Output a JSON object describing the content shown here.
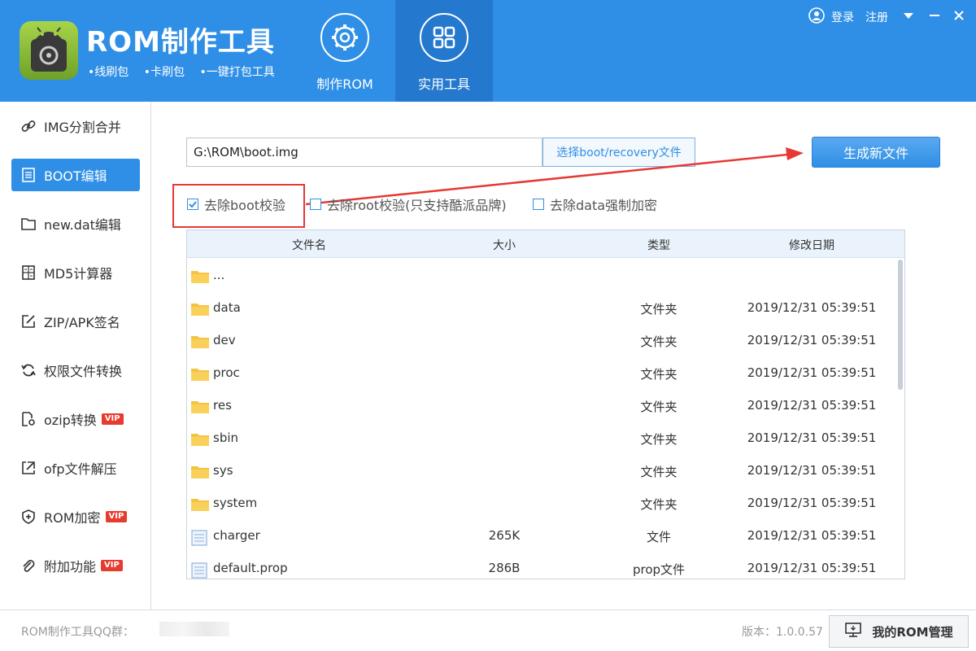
{
  "app": {
    "title": "ROM制作工具",
    "tags": [
      "•线刷包",
      "•卡刷包",
      "•一键打包工具"
    ]
  },
  "nav_tabs": [
    {
      "label": "制作ROM",
      "icon": "gear-icon"
    },
    {
      "label": "实用工具",
      "icon": "grid-icon",
      "active": true
    }
  ],
  "topbar": {
    "login": "登录",
    "register": "注册"
  },
  "sidebar": {
    "items": [
      {
        "label": "IMG分割合并",
        "icon": "link-icon"
      },
      {
        "label": "BOOT编辑",
        "icon": "document-icon",
        "active": true
      },
      {
        "label": "new.dat编辑",
        "icon": "folder-icon"
      },
      {
        "label": "MD5计算器",
        "icon": "calculator-icon"
      },
      {
        "label": "ZIP/APK签名",
        "icon": "edit-icon"
      },
      {
        "label": "权限文件转换",
        "icon": "refresh-icon"
      },
      {
        "label": "ozip转换",
        "icon": "file-gear-icon",
        "vip": "VIP"
      },
      {
        "label": "ofp文件解压",
        "icon": "extract-icon"
      },
      {
        "label": "ROM加密",
        "icon": "shield-icon",
        "vip": "VIP"
      },
      {
        "label": "附加功能",
        "icon": "paperclip-icon",
        "vip": "VIP"
      }
    ]
  },
  "main": {
    "path_value": "G:\\ROM\\boot.img",
    "choose_label": "选择boot/recovery文件",
    "generate_label": "生成新文件",
    "options": [
      {
        "label": "去除boot校验",
        "checked": true
      },
      {
        "label": "去除root校验(只支持酷派品牌)",
        "checked": false
      },
      {
        "label": "去除data强制加密",
        "checked": false
      }
    ],
    "table": {
      "headers": [
        "文件名",
        "大小",
        "类型",
        "修改日期"
      ],
      "rows": [
        {
          "name": "...",
          "size": "",
          "type": "",
          "date": "",
          "kind": "folder"
        },
        {
          "name": "data",
          "size": "",
          "type": "文件夹",
          "date": "2019/12/31 05:39:51",
          "kind": "folder"
        },
        {
          "name": "dev",
          "size": "",
          "type": "文件夹",
          "date": "2019/12/31 05:39:51",
          "kind": "folder"
        },
        {
          "name": "proc",
          "size": "",
          "type": "文件夹",
          "date": "2019/12/31 05:39:51",
          "kind": "folder"
        },
        {
          "name": "res",
          "size": "",
          "type": "文件夹",
          "date": "2019/12/31 05:39:51",
          "kind": "folder"
        },
        {
          "name": "sbin",
          "size": "",
          "type": "文件夹",
          "date": "2019/12/31 05:39:51",
          "kind": "folder"
        },
        {
          "name": "sys",
          "size": "",
          "type": "文件夹",
          "date": "2019/12/31 05:39:51",
          "kind": "folder"
        },
        {
          "name": "system",
          "size": "",
          "type": "文件夹",
          "date": "2019/12/31 05:39:51",
          "kind": "folder"
        },
        {
          "name": "charger",
          "size": "265K",
          "type": "文件",
          "date": "2019/12/31 05:39:51",
          "kind": "file"
        },
        {
          "name": "default.prop",
          "size": "286B",
          "type": "prop文件",
          "date": "2019/12/31 05:39:51",
          "kind": "file"
        }
      ]
    }
  },
  "footer": {
    "qq_label": "ROM制作工具QQ群：",
    "version": "版本：1.0.0.57",
    "my_rom": "我的ROM管理"
  },
  "colors": {
    "primary": "#2f8fe6",
    "active_tab": "#2479cf",
    "vip": "#e83b2f",
    "annotation": "#e53935"
  }
}
